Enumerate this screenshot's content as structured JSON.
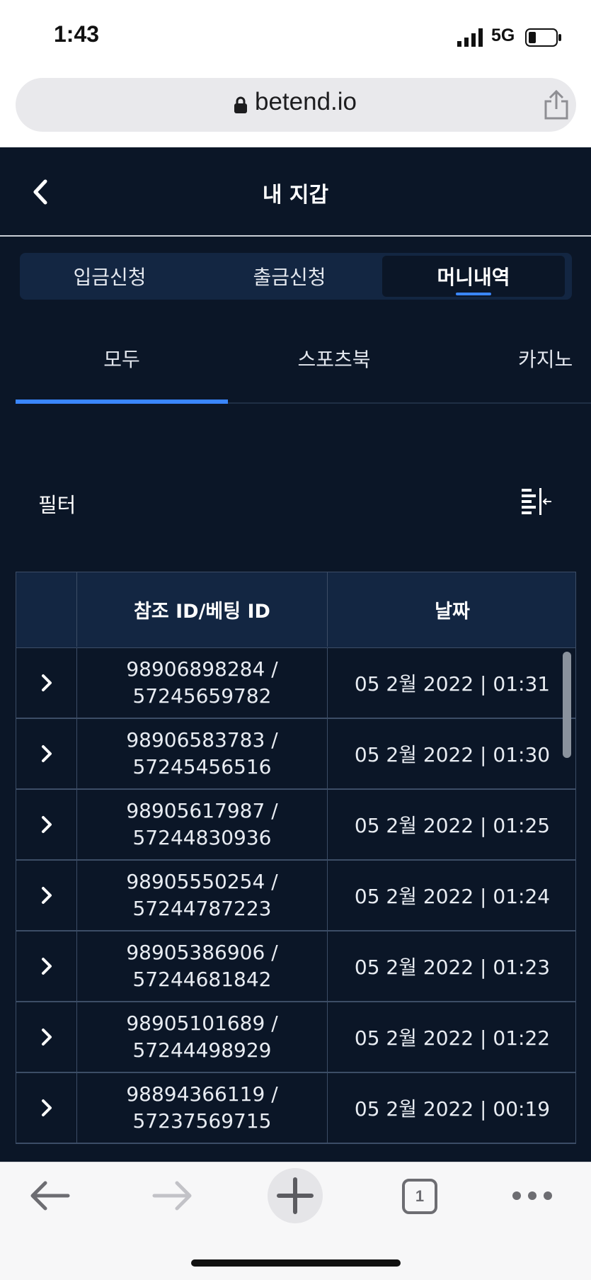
{
  "statusbar": {
    "time": "1:43",
    "network": "5G"
  },
  "browser": {
    "domain": "betend.io"
  },
  "header": {
    "title": "내 지갑"
  },
  "segments": [
    {
      "label": "입금신청"
    },
    {
      "label": "출금신청"
    },
    {
      "label": "머니내역",
      "active": true
    }
  ],
  "subtabs": [
    {
      "label": "모두",
      "active": true
    },
    {
      "label": "스포츠북"
    },
    {
      "label": "카지노"
    }
  ],
  "filter": {
    "label": "필터"
  },
  "table": {
    "columns": [
      "",
      "참조 ID/베팅 ID",
      "날짜"
    ],
    "rows": [
      {
        "ref": "98906898284 /",
        "bet": "57245659782",
        "date": "05 2월 2022 | 01:31"
      },
      {
        "ref": "98906583783 /",
        "bet": "57245456516",
        "date": "05 2월 2022 | 01:30"
      },
      {
        "ref": "98905617987 /",
        "bet": "57244830936",
        "date": "05 2월 2022 | 01:25"
      },
      {
        "ref": "98905550254 /",
        "bet": "57244787223",
        "date": "05 2월 2022 | 01:24"
      },
      {
        "ref": "98905386906 /",
        "bet": "57244681842",
        "date": "05 2월 2022 | 01:23"
      },
      {
        "ref": "98905101689 /",
        "bet": "57244498929",
        "date": "05 2월 2022 | 01:22"
      },
      {
        "ref": "98894366119 /",
        "bet": "57237569715",
        "date": "05 2월 2022 | 00:19"
      }
    ]
  },
  "bottombar": {
    "tab_count": "1"
  },
  "colors": {
    "background": "#0b1627",
    "panel": "#132642",
    "accent": "#3a86ff",
    "border": "#3c4d66"
  }
}
